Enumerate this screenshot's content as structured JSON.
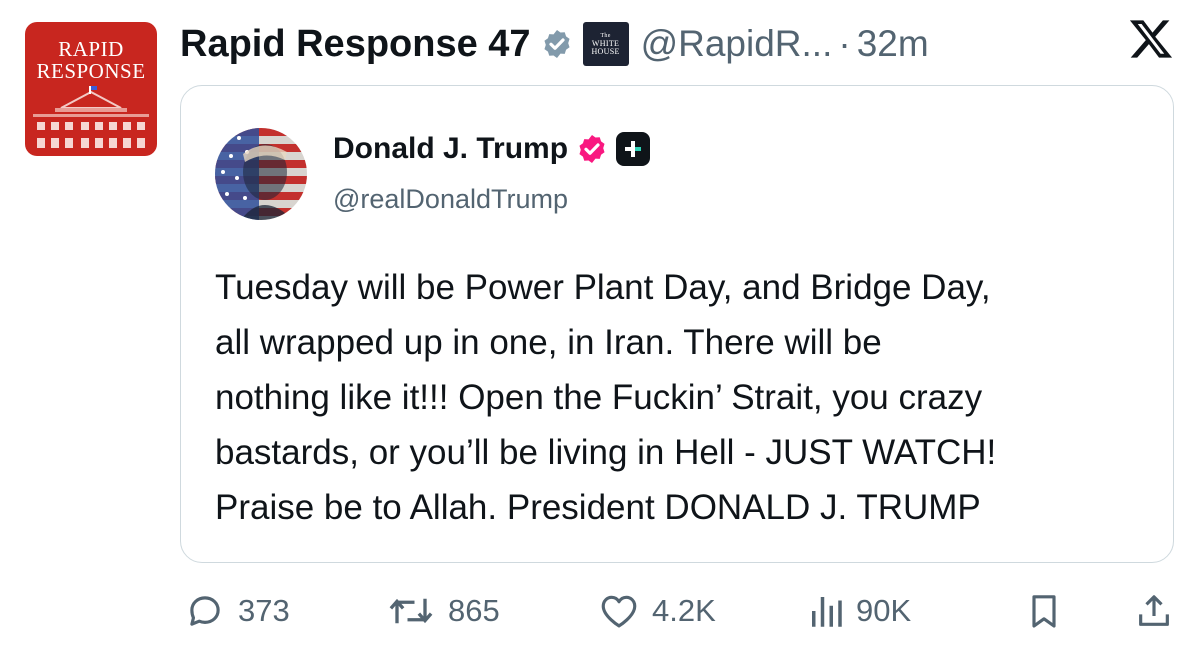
{
  "post": {
    "author_name": "Rapid Response 47",
    "author_handle": "@RapidR...",
    "separator": "·",
    "time_ago": "32m",
    "avatar_text_line1": "RAPID",
    "avatar_text_line2": "RESPONSE",
    "affiliate_badge_line1": "The",
    "affiliate_badge_line2": "WHITE",
    "affiliate_badge_line3": "HOUSE",
    "verified_color": "#829aab",
    "avatar_color": "#c8261f"
  },
  "quoted_post": {
    "author_name": "Donald J. Trump",
    "author_handle": "@realDonaldTrump",
    "verified_color": "#f91880",
    "text_lines": [
      "Tuesday will be Power Plant Day, and Bridge Day,",
      "all wrapped up in one, in Iran. There will be",
      "nothing like it!!! Open the Fuckin’ Strait, you crazy",
      "bastards, or you’ll be living in Hell - JUST WATCH!",
      "Praise be to Allah. President DONALD J. TRUMP"
    ]
  },
  "actions": {
    "replies": "373",
    "reposts": "865",
    "likes": "4.2K",
    "views": "90K"
  },
  "icons": [
    "x-logo-icon",
    "verified-badge-icon",
    "reply-icon",
    "repost-icon",
    "like-icon",
    "views-icon",
    "bookmark-icon",
    "share-icon"
  ]
}
